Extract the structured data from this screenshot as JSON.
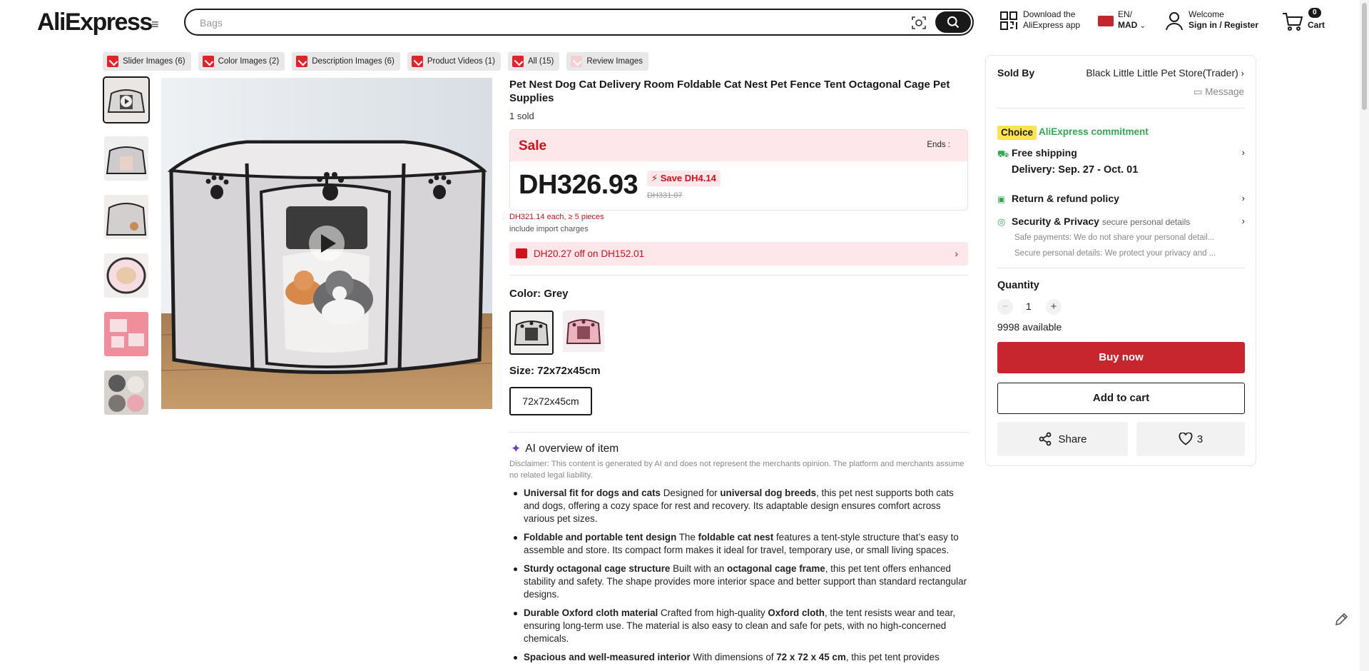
{
  "header": {
    "logo": "AliExpress",
    "search_placeholder": "Bags",
    "download_line1": "Download the",
    "download_line2": "AliExpress app",
    "lang_line1": "EN/",
    "lang_line2": "MAD",
    "welcome": "Welcome",
    "signin": "Sign in / Register",
    "cart_count": "0",
    "cart_label": "Cart"
  },
  "download_tabs": [
    {
      "label": "Slider Images (6)"
    },
    {
      "label": "Color Images (2)"
    },
    {
      "label": "Description Images (6)"
    },
    {
      "label": "Product Videos (1)"
    },
    {
      "label": "All (15)"
    },
    {
      "label": "Review Images"
    }
  ],
  "product": {
    "title": "Pet Nest Dog Cat Delivery Room Foldable Cat Nest Pet Fence Tent Octagonal Cage Pet Supplies",
    "sold": "1 sold",
    "sale_label": "Sale",
    "ends_label": "Ends :",
    "price": "DH326.93",
    "save": "Save DH4.14",
    "old_price": "DH331.07",
    "bulk_price": "DH321.14 each, ≥ 5 pieces",
    "import_note": "include import charges",
    "coupon": "DH20.27 off on DH152.01",
    "color_label": "Color: Grey",
    "size_label": "Size: 72x72x45cm",
    "size_option": "72x72x45cm"
  },
  "ai_overview": {
    "title": "AI overview of item",
    "disclaimer": "Disclaimer: This content is generated by AI and does not represent the merchants opinion. The platform and merchants assume no related legal liability.",
    "items": [
      {
        "bold": "Universal fit for dogs and cats",
        "p1": " Designed for ",
        "b2": "universal dog breeds",
        "p2": ", this pet nest supports both cats and dogs, offering a cozy space for rest and recovery. Its adaptable design ensures comfort across various pet sizes."
      },
      {
        "bold": "Foldable and portable tent design",
        "p1": " The ",
        "b2": "foldable cat nest",
        "p2": " features a tent-style structure that’s easy to assemble and store. Its compact form makes it ideal for travel, temporary use, or small living spaces."
      },
      {
        "bold": "Sturdy octagonal cage structure",
        "p1": " Built with an ",
        "b2": "octagonal cage frame",
        "p2": ", this pet tent offers enhanced stability and safety. The shape provides more interior space and better support than standard rectangular designs."
      },
      {
        "bold": "Durable Oxford cloth material",
        "p1": " Crafted from high-quality ",
        "b2": "Oxford cloth",
        "p2": ", the tent resists wear and tear, ensuring long-term use. The material is also easy to clean and safe for pets, with no high-concerned chemicals."
      },
      {
        "bold": "Spacious and well-measured interior",
        "p1": " With dimensions of ",
        "b2": "72 x 72 x 45 cm",
        "p2": ", this pet tent provides"
      }
    ]
  },
  "seller_panel": {
    "sold_by_label": "Sold By",
    "store_name": "Black Little Little Pet Store(Trader)",
    "message": "Message",
    "choice_badge": "Choice",
    "commitment": "AliExpress commitment",
    "free_shipping": "Free shipping",
    "delivery": "Delivery: Sep. 27 - Oct. 01",
    "return_policy": "Return & refund policy",
    "security": "Security & Privacy",
    "security_sub": "secure personal details",
    "safe_payments": "Safe payments: We do not share your personal detail...",
    "secure_details": "Secure personal details: We protect your privacy and ...",
    "quantity_label": "Quantity",
    "quantity_value": "1",
    "available": "9998 available",
    "buy_now": "Buy now",
    "add_to_cart": "Add to cart",
    "share": "Share",
    "likes": "3"
  },
  "colors": {
    "accent_red": "#c8262e",
    "sale_red": "#d0121d",
    "sale_bg": "#fde7ea",
    "choice_yellow": "#ffe44d",
    "commitment_green": "#33a852"
  },
  "icons": [
    "menu-icon",
    "camera-search-icon",
    "search-icon",
    "qr-code-icon",
    "flag-icon",
    "user-icon",
    "cart-icon",
    "play-icon",
    "chevron-right-icon",
    "message-icon",
    "truck-icon",
    "return-icon",
    "shield-icon",
    "minus-icon",
    "plus-icon",
    "share-icon",
    "heart-icon",
    "sparkle-icon",
    "edit-icon",
    "download-icon",
    "coupon-icon",
    "lightning-icon"
  ]
}
